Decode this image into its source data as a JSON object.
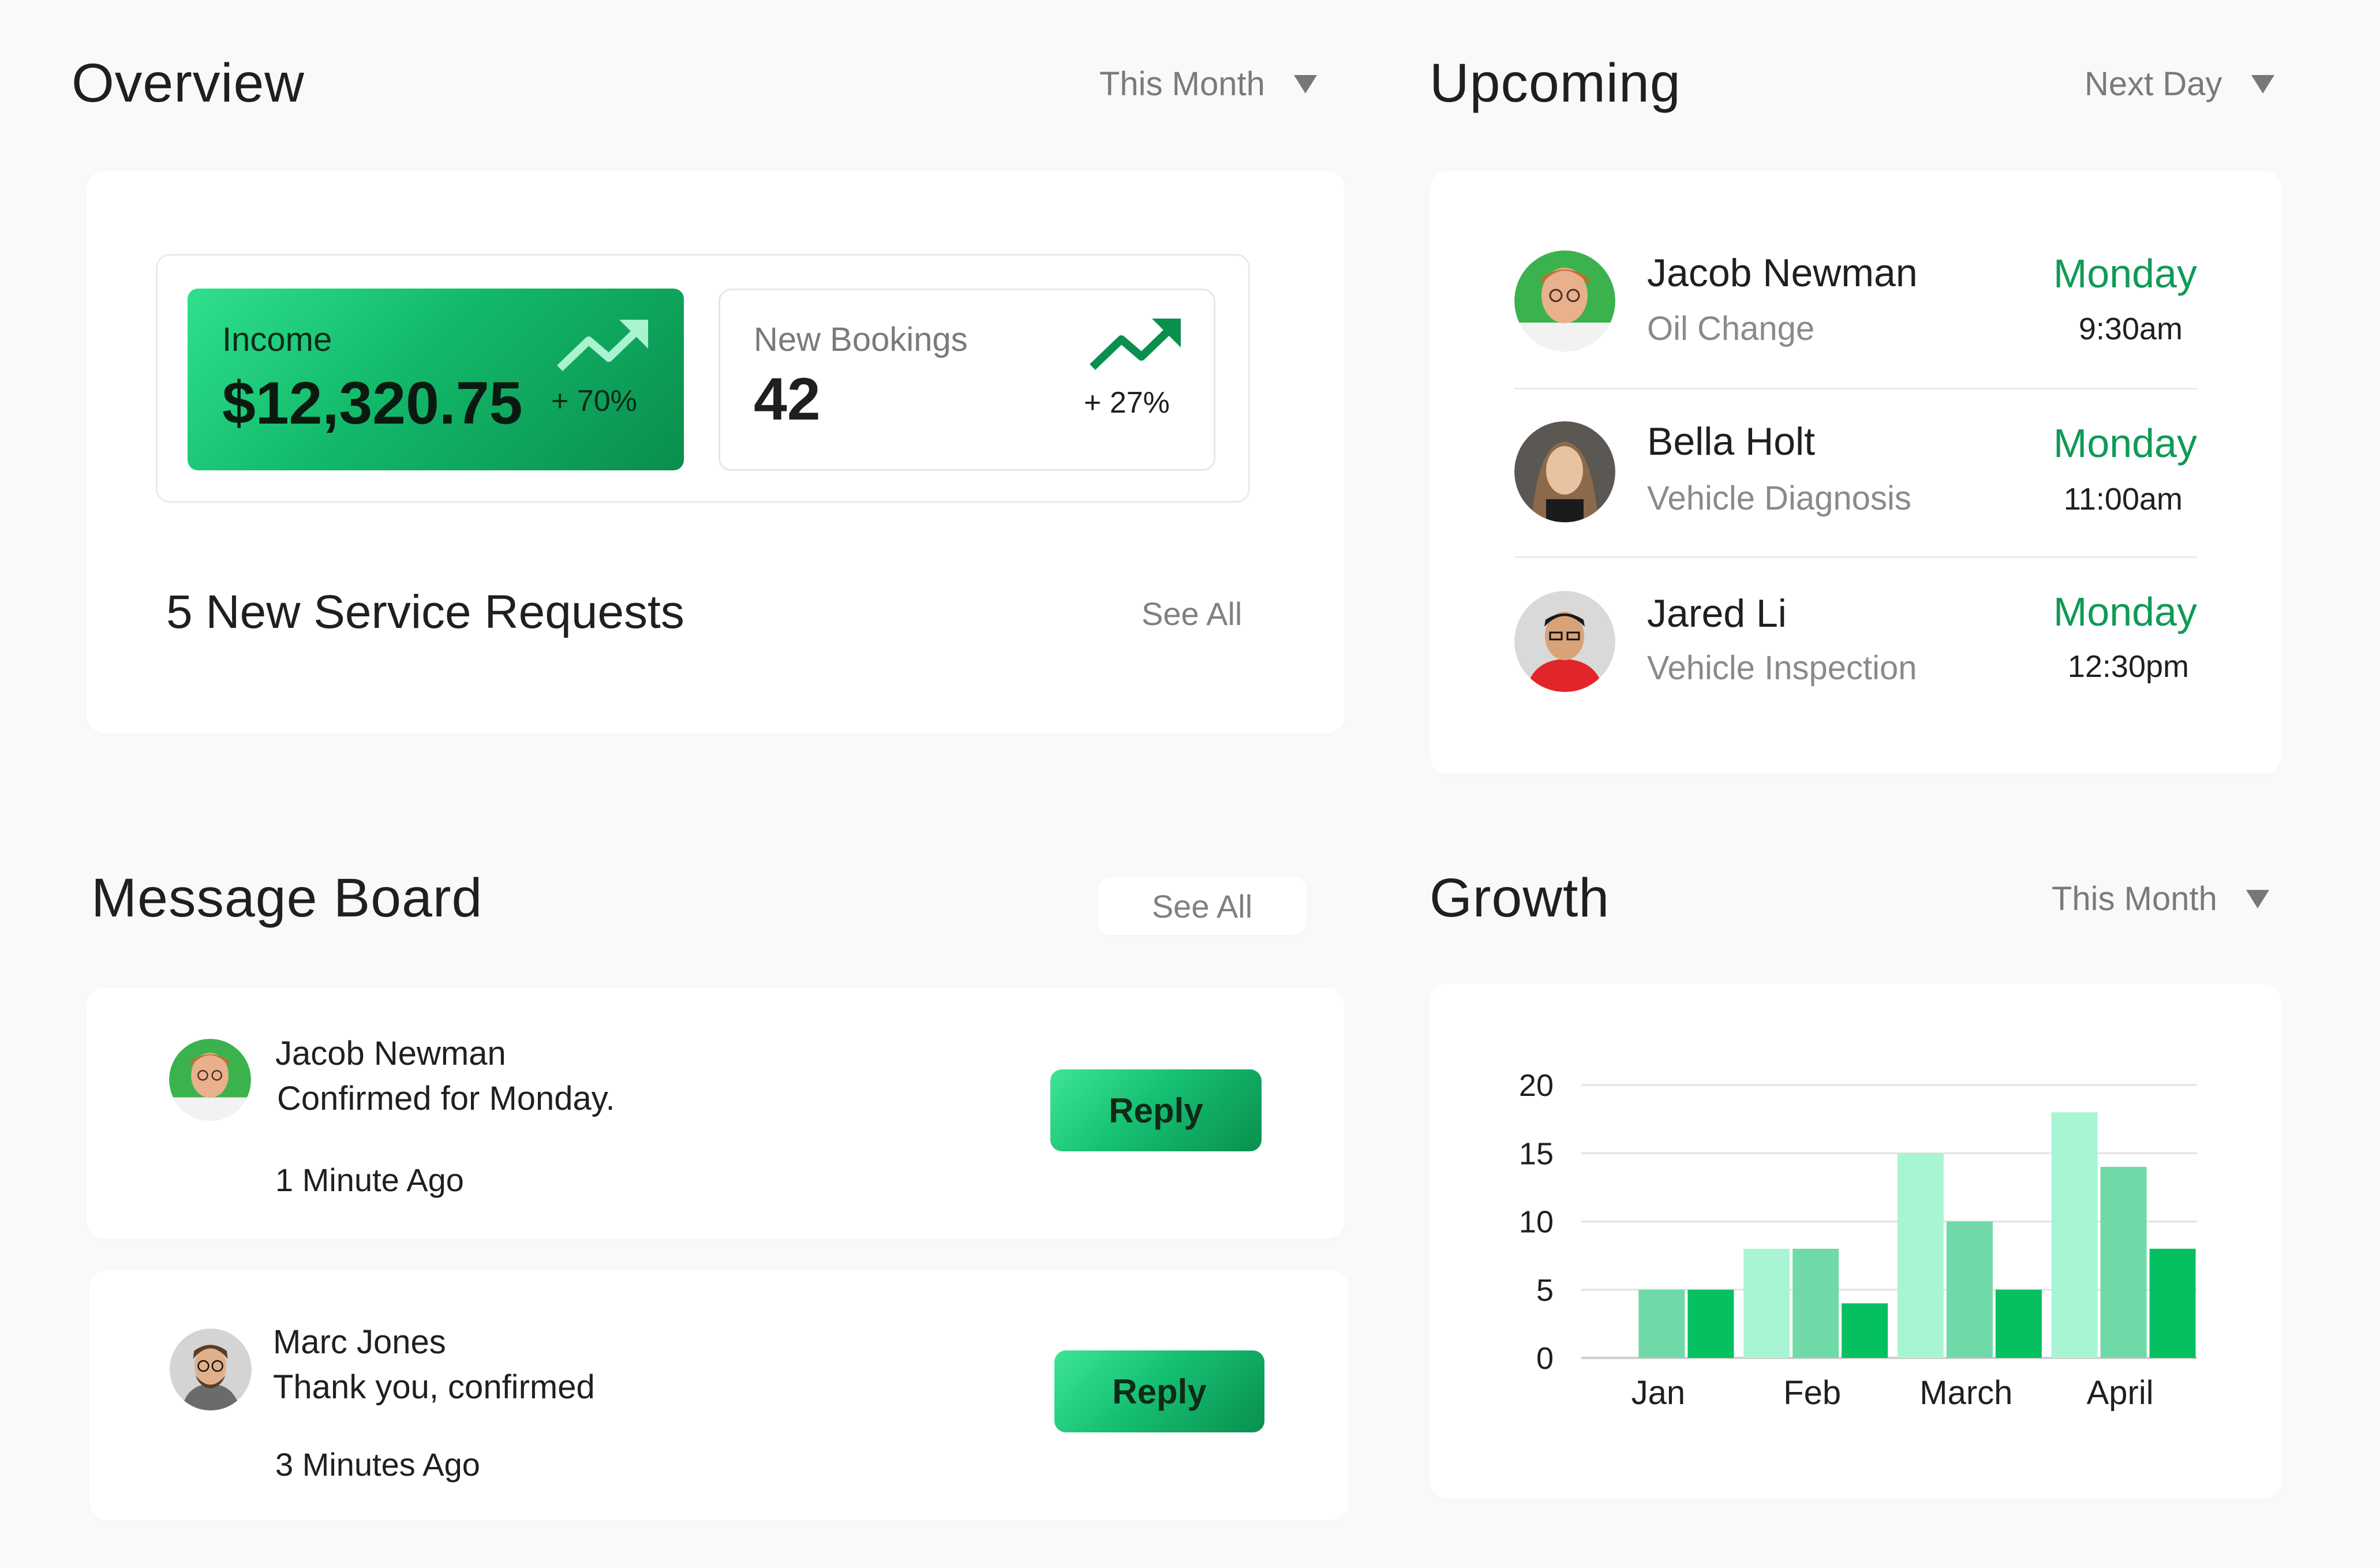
{
  "overview": {
    "title": "Overview",
    "period": "This Month",
    "income": {
      "label": "Income",
      "value": "$12,320.75",
      "change": "+ 70%"
    },
    "bookings": {
      "label": "New Bookings",
      "value": "42",
      "change": "+ 27%"
    },
    "requests": {
      "text": "5 New Service Requests",
      "see_all": "See All"
    }
  },
  "upcoming": {
    "title": "Upcoming",
    "period": "Next Day",
    "items": [
      {
        "name": "Jacob Newman",
        "service": "Oil Change",
        "day": "Monday",
        "time": "9:30am"
      },
      {
        "name": "Bella Holt",
        "service": "Vehicle Diagnosis",
        "day": "Monday",
        "time": "11:00am"
      },
      {
        "name": "Jared Li",
        "service": "Vehicle Inspection",
        "day": "Monday",
        "time": "12:30pm"
      }
    ]
  },
  "messages": {
    "title": "Message Board",
    "see_all": "See All",
    "items": [
      {
        "name": "Jacob Newman",
        "text": "Confirmed for Monday.",
        "time": "1 Minute Ago",
        "reply": "Reply"
      },
      {
        "name": "Marc Jones",
        "text": "Thank you, confirmed",
        "time": "3 Minutes Ago",
        "reply": "Reply"
      }
    ]
  },
  "growth": {
    "title": "Growth",
    "period": "This Month"
  },
  "colors": {
    "accent": "#0f9a56",
    "bar_light": "#a8f5d4",
    "bar_mid": "#6fd9a8",
    "bar_dark": "#05c060"
  },
  "icons": [
    "trend-up-icon",
    "caret-down-icon"
  ],
  "chart_data": {
    "type": "bar",
    "categories": [
      "Jan",
      "Feb",
      "March",
      "April"
    ],
    "series": [
      {
        "values": [
          0,
          8,
          15,
          18
        ],
        "color": "#a8f5d4"
      },
      {
        "values": [
          5,
          8,
          10,
          14
        ],
        "color": "#6fd9a8"
      },
      {
        "values": [
          5,
          4,
          5,
          8
        ],
        "color": "#05c060"
      }
    ],
    "yticks": [
      0,
      5,
      10,
      15,
      20
    ],
    "ylim": [
      0,
      20
    ],
    "grid": true
  }
}
